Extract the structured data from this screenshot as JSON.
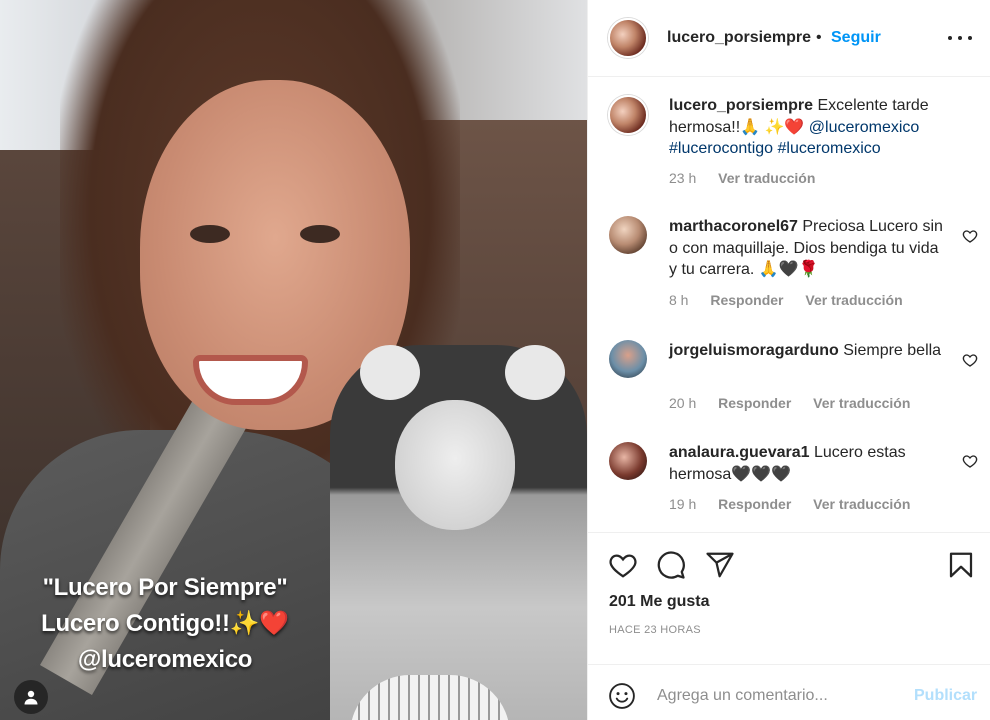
{
  "post": {
    "overlay_line1": "\"Lucero Por Siempre\"",
    "overlay_line2": "Lucero Contigo!!✨❤️",
    "overlay_line3": "@luceromexico"
  },
  "header": {
    "username": "lucero_porsiempre",
    "separator": "•",
    "follow_label": "Seguir"
  },
  "caption": {
    "username": "lucero_porsiempre",
    "text": " Excelente tarde hermosa!!🙏 ✨❤️ ",
    "tags": "@luceromexico #lucerocontigo #luceromexico",
    "time": "23 h",
    "translate": "Ver traducción"
  },
  "comments": [
    {
      "username": "marthacoronel67",
      "text": " Preciosa Lucero sin o con maquillaje. Dios bendiga tu vida y tu carrera. 🙏🖤🌹",
      "time": "8 h",
      "reply": "Responder",
      "translate": "Ver traducción"
    },
    {
      "username": "jorgeluismoragarduno",
      "text": " Siempre bella",
      "time": "20 h",
      "reply": "Responder",
      "translate": "Ver traducción"
    },
    {
      "username": "analaura.guevara1",
      "text": " Lucero estas hermosa🖤🖤🖤",
      "time": "19 h",
      "reply": "Responder",
      "translate": "Ver traducción"
    }
  ],
  "actions": {
    "likes": "201 Me gusta",
    "posted": "HACE 23 HORAS",
    "icons": [
      "heart-icon",
      "comment-icon",
      "share-icon",
      "bookmark-icon"
    ]
  },
  "add_comment": {
    "placeholder": "Agrega un comentario...",
    "publish_label": "Publicar"
  },
  "colors": {
    "accent": "#0095f6",
    "publish_disabled": "#b2dffc",
    "link": "#00376b",
    "muted": "#8e8e8e"
  }
}
